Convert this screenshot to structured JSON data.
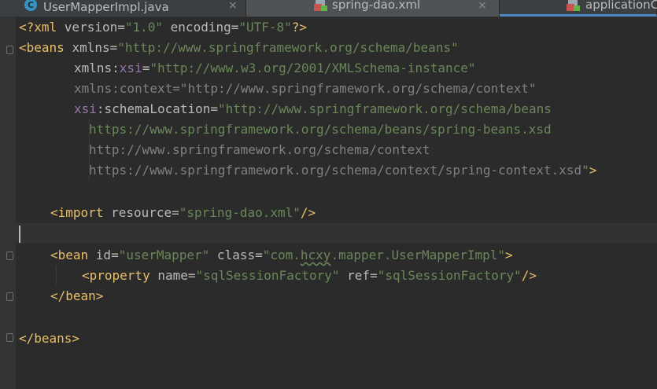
{
  "tabs": [
    {
      "label": "UserMapperImpl.java",
      "icon": "java-class-icon",
      "close": "×"
    },
    {
      "label": "spring-dao.xml",
      "icon": "spring-xml-icon",
      "close": "×"
    },
    {
      "label": "applicationC",
      "icon": "spring-xml-icon"
    }
  ],
  "editor": {
    "decl": {
      "open": "<?xml ",
      "v_attr": "version=",
      "v_val": "\"1.0\"",
      "e_attr": " encoding=",
      "e_val": "\"UTF-8\"",
      "close": "?>"
    },
    "beans_open": {
      "tag": "<beans ",
      "xmlns_attr": "xmlns=",
      "xmlns_val": "\"http://www.springframework.org/schema/beans\""
    },
    "xsi_line": {
      "prefix": "xmlns:",
      "ns": "xsi",
      "eq": "=",
      "val": "\"http://www.w3.org/2001/XMLSchema-instance\""
    },
    "context_line": {
      "attr": "xmlns:context=",
      "val": "\"http://www.springframework.org/schema/context\""
    },
    "schema_line": {
      "ns": "xsi",
      "attr": ":schemaLocation=",
      "val": "\"http://www.springframework.org/schema/beans"
    },
    "schema_2": "https://www.springframework.org/schema/beans/spring-beans.xsd",
    "schema_3": "http://www.springframework.org/schema/context",
    "schema_4": "https://www.springframework.org/schema/context/spring-context.xsd\"",
    "schema_4_close": ">",
    "import_line": {
      "tag": "<import ",
      "attr": "resource=",
      "val": "\"spring-dao.xml\"",
      "close": "/>"
    },
    "bean_line": {
      "tag": "<bean ",
      "id_attr": "id=",
      "id_val": "\"userMapper\"",
      "class_attr": " class=",
      "class_val_a": "\"com.",
      "class_val_b": "hcxy",
      "class_val_c": ".mapper.UserMapperImpl\"",
      "close": ">"
    },
    "property_line": {
      "tag": "<property ",
      "name_attr": "name=",
      "name_val": "\"sqlSessionFactory\"",
      "ref_attr": " ref=",
      "ref_val": "\"sqlSessionFactory\"",
      "close": "/>"
    },
    "bean_close": "</bean>",
    "beans_close": "</beans>"
  }
}
